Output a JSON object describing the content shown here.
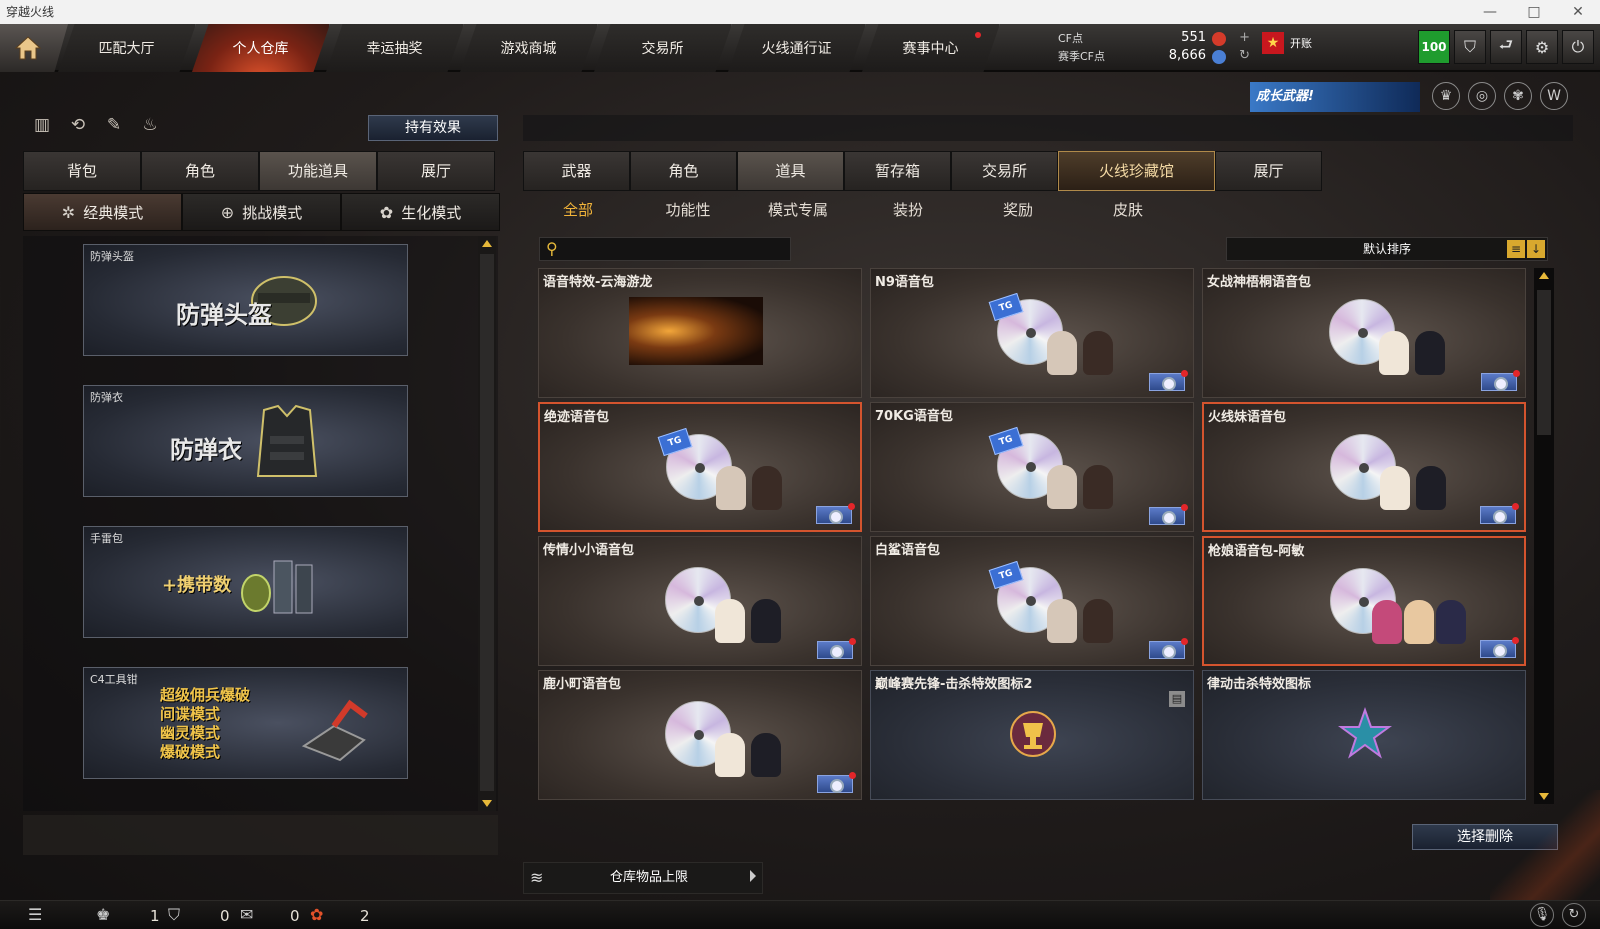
{
  "window": {
    "title": "穿越火线",
    "controls": [
      "—",
      "□",
      "✕"
    ]
  },
  "nav": {
    "items": [
      {
        "label": "匹配大厅",
        "active": false
      },
      {
        "label": "个人仓库",
        "active": true
      },
      {
        "label": "幸运抽奖",
        "active": false
      },
      {
        "label": "游戏商城",
        "active": false
      },
      {
        "label": "交易所",
        "active": false
      },
      {
        "label": "火线通行证",
        "active": false
      },
      {
        "label": "赛事中心",
        "active": false,
        "dot": true
      }
    ]
  },
  "currency": {
    "cf_label": "CF点",
    "cf_value": "551",
    "season_label": "赛季CF点",
    "season_value": "8,666",
    "add_icon": "plus-icon",
    "refresh_icon": "refresh-icon"
  },
  "vip": {
    "label": "开账"
  },
  "top_right": {
    "level": "100",
    "icons": [
      "shield-icon",
      "exit-icon",
      "gear-icon",
      "power-icon"
    ]
  },
  "promo": {
    "text": "成长武器!"
  },
  "left": {
    "effect_button": "持有效果",
    "tabs": [
      "背包",
      "角色",
      "功能道具",
      "展厅"
    ],
    "active_tab": 2,
    "modes": [
      {
        "label": "经典模式",
        "icon": "✲",
        "active": true
      },
      {
        "label": "挑战模式",
        "icon": "⊕",
        "active": false
      },
      {
        "label": "生化模式",
        "icon": "✿",
        "active": false
      }
    ],
    "props": [
      {
        "name": "防弹头盔",
        "big": "防弹头盔"
      },
      {
        "name": "防弹衣",
        "big": "防弹衣"
      },
      {
        "name": "手雷包",
        "big": "+携带数"
      },
      {
        "name": "C4工具钳",
        "lines": [
          "超级佣兵爆破",
          "间谍模式",
          "幽灵模式",
          "爆破模式"
        ]
      }
    ]
  },
  "right": {
    "tabs": [
      "武器",
      "角色",
      "道具",
      "暂存箱",
      "交易所",
      "火线珍藏馆",
      "展厅"
    ],
    "active_tab": 2,
    "subtabs": [
      "全部",
      "功能性",
      "模式专属",
      "装扮",
      "奖励",
      "皮肤"
    ],
    "active_subtab": 0,
    "search": {
      "placeholder": ""
    },
    "sort": {
      "label": "默认排序"
    },
    "items": [
      {
        "name": "语音特效-云海游龙",
        "kind": "effect",
        "badge": false,
        "selected": false
      },
      {
        "name": "N9语音包",
        "kind": "voice",
        "badge": true,
        "selected": false
      },
      {
        "name": "女战神梧桐语音包",
        "kind": "voice",
        "badge": true,
        "selected": false
      },
      {
        "name": "绝迹语音包",
        "kind": "voice",
        "badge": true,
        "selected": true
      },
      {
        "name": "70KG语音包",
        "kind": "voice",
        "badge": true,
        "selected": false
      },
      {
        "name": "火线妹语音包",
        "kind": "voice",
        "badge": true,
        "selected": true
      },
      {
        "name": "传情小小语音包",
        "kind": "voice",
        "badge": true,
        "selected": false
      },
      {
        "name": "白鲨语音包",
        "kind": "voice",
        "badge": true,
        "selected": false
      },
      {
        "name": "枪娘语音包-阿敏",
        "kind": "voice",
        "badge": true,
        "selected": true
      },
      {
        "name": "鹿小町语音包",
        "kind": "voice",
        "badge": true,
        "selected": false
      },
      {
        "name": "巅峰赛先锋-击杀特效图标2",
        "kind": "icon",
        "badge": false,
        "selected": false
      },
      {
        "name": "律动击杀特效图标",
        "kind": "icon",
        "badge": false,
        "selected": false
      }
    ],
    "delete_button": "选择删除",
    "capacity_label": "仓库物品上限"
  },
  "status": {
    "friends": "1",
    "clan": "0",
    "chat": "0",
    "gifts": "2"
  }
}
